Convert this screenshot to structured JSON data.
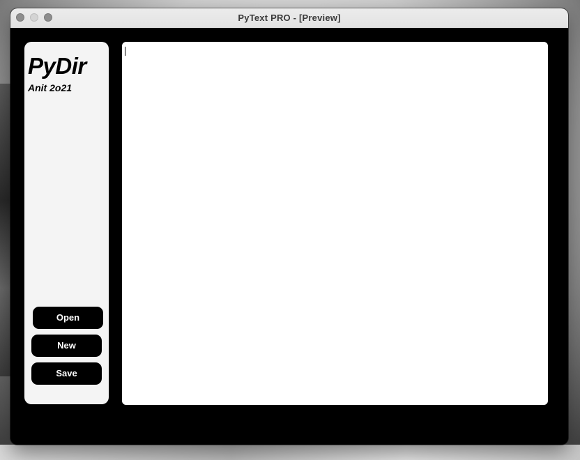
{
  "window": {
    "title": "PyText PRO - [Preview]"
  },
  "sidebar": {
    "logo": "PyDir",
    "subtitle": "Anit 2o21",
    "buttons": {
      "open_label": "Open",
      "new_label": "New",
      "save_label": "Save"
    }
  },
  "editor": {
    "content": ""
  },
  "colors": {
    "window_background": "#000000",
    "panel_background": "#f4f4f4",
    "editor_background": "#ffffff",
    "button_background": "#000000",
    "button_text": "#ffffff"
  }
}
